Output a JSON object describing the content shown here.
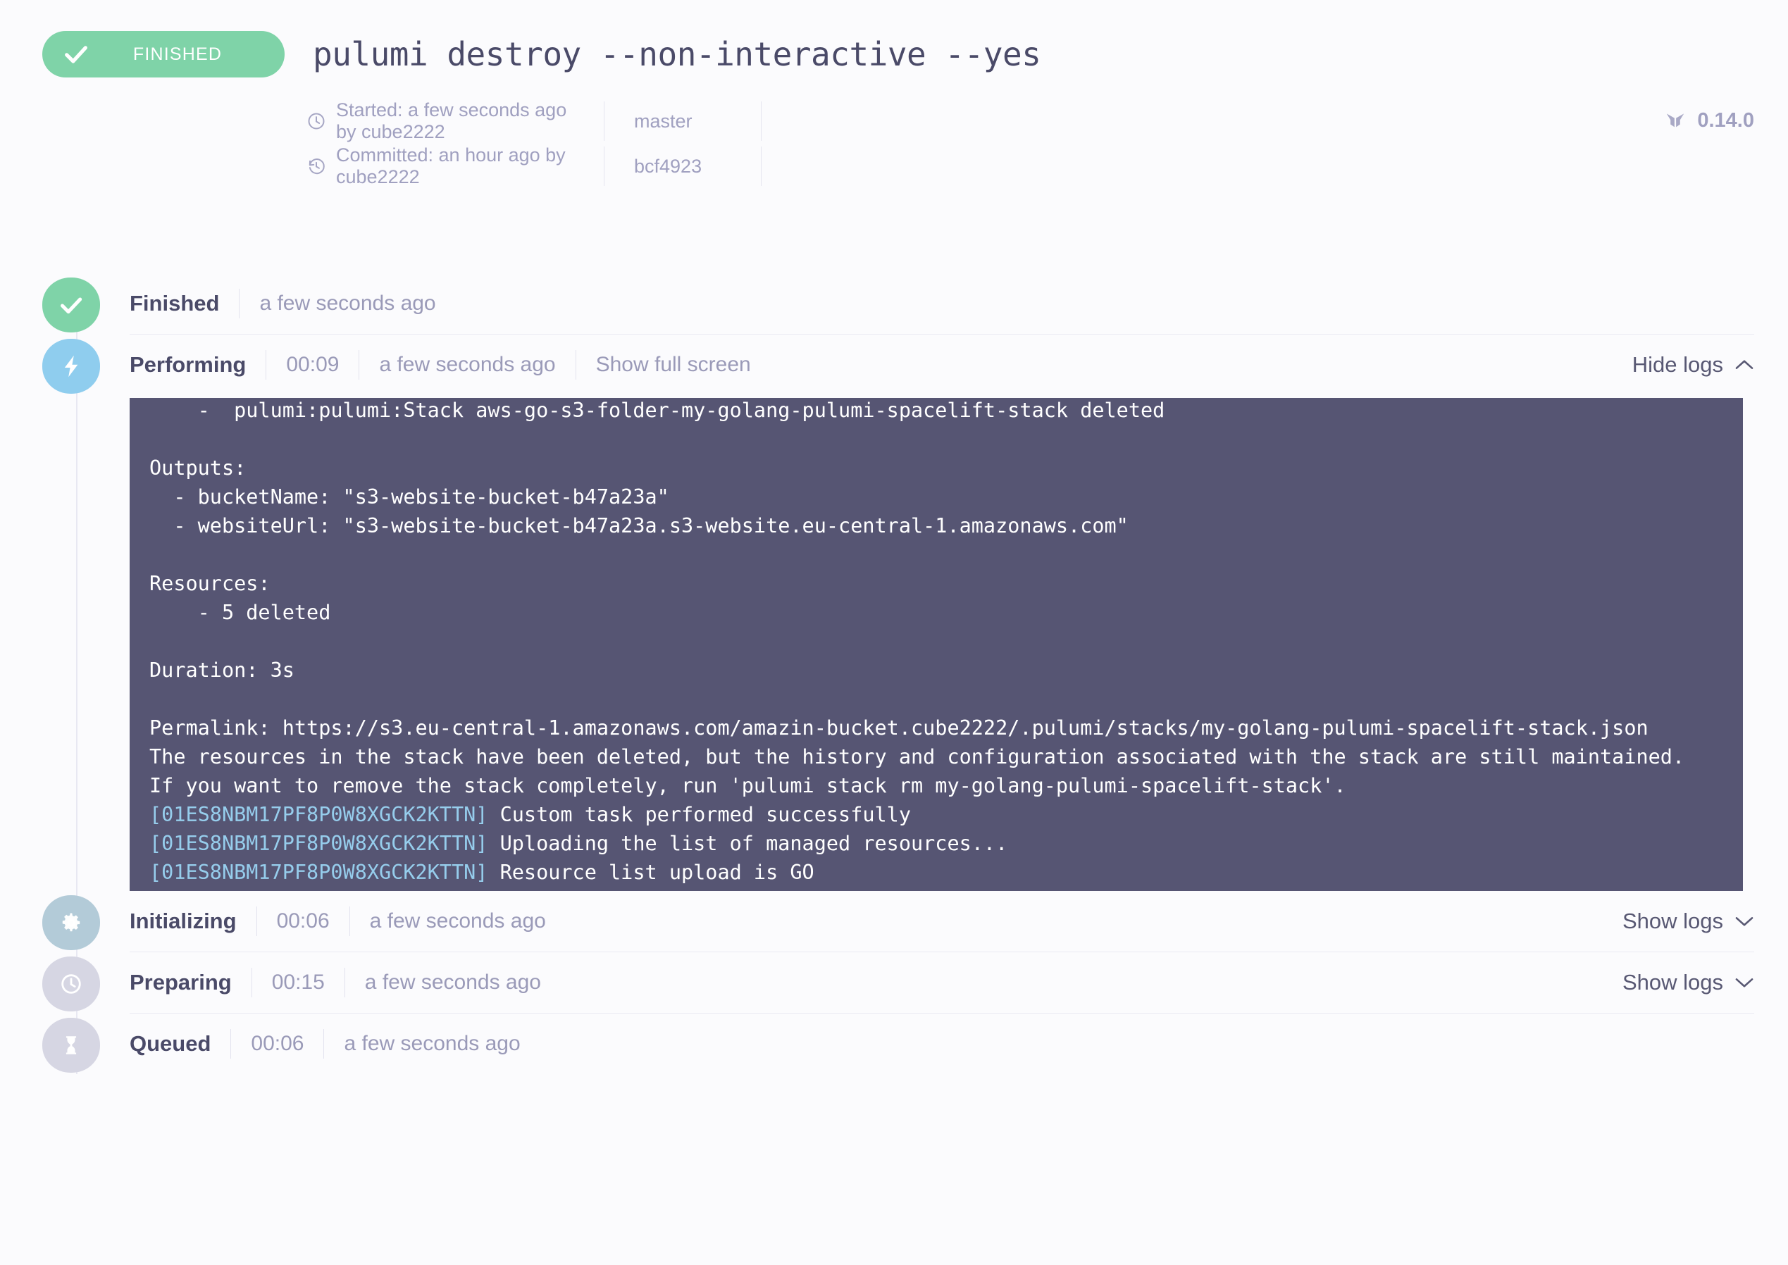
{
  "header": {
    "status_badge": {
      "label": "FINISHED",
      "icon": "check-icon",
      "color": "#7fd3a8"
    },
    "title": "pulumi destroy --non-interactive --yes",
    "meta": [
      {
        "icon": "clock-icon",
        "text": "Started: a few seconds ago by cube2222",
        "ref": "master"
      },
      {
        "icon": "history-icon",
        "text": "Committed: an hour ago by cube2222",
        "ref": "bcf4923"
      }
    ],
    "version": {
      "icon": "spacelift-logo-icon",
      "label": "0.14.0"
    }
  },
  "timeline": {
    "phases": [
      {
        "name": "Finished",
        "duration": "",
        "when": "a few seconds ago",
        "action": "",
        "toggle": "",
        "icon": "check-icon",
        "icon_style": "ic-green"
      },
      {
        "name": "Performing",
        "duration": "00:09",
        "when": "a few seconds ago",
        "action": "Show full screen",
        "toggle": "Hide logs",
        "toggle_chevron": "chevron-up-icon",
        "icon": "lightning-icon",
        "icon_style": "ic-blue"
      },
      {
        "name": "Initializing",
        "duration": "00:06",
        "when": "a few seconds ago",
        "action": "",
        "toggle": "Show logs",
        "toggle_chevron": "chevron-down-icon",
        "icon": "gear-icon",
        "icon_style": "ic-steel"
      },
      {
        "name": "Preparing",
        "duration": "00:15",
        "when": "a few seconds ago",
        "action": "",
        "toggle": "Show logs",
        "toggle_chevron": "chevron-down-icon",
        "icon": "clock-icon",
        "icon_style": "ic-grey"
      },
      {
        "name": "Queued",
        "duration": "00:06",
        "when": "a few seconds ago",
        "action": "",
        "toggle": "",
        "icon": "hourglass-icon",
        "icon_style": "ic-grey"
      }
    ]
  },
  "console": {
    "background": "#565573",
    "text_color": "#ffffff",
    "task_id_color": "#96cdec",
    "task_id": "[01ES8NBM17PF8P0W8XGCK2KTTN]",
    "lines": [
      {
        "text": "    -  pulumi:pulumi:Stack aws-go-s3-folder-my-golang-pulumi-spacelift-stack deleted"
      },
      {
        "text": ""
      },
      {
        "text": "Outputs:"
      },
      {
        "text": "  - bucketName: \"s3-website-bucket-b47a23a\""
      },
      {
        "text": "  - websiteUrl: \"s3-website-bucket-b47a23a.s3-website.eu-central-1.amazonaws.com\""
      },
      {
        "text": ""
      },
      {
        "text": "Resources:"
      },
      {
        "text": "    - 5 deleted"
      },
      {
        "text": ""
      },
      {
        "text": "Duration: 3s"
      },
      {
        "text": ""
      },
      {
        "text": "Permalink: https://s3.eu-central-1.amazonaws.com/amazin-bucket.cube2222/.pulumi/stacks/my-golang-pulumi-spacelift-stack.json"
      },
      {
        "text": "The resources in the stack have been deleted, but the history and configuration associated with the stack are still maintained."
      },
      {
        "text": "If you want to remove the stack completely, run 'pulumi stack rm my-golang-pulumi-spacelift-stack'."
      },
      {
        "tid": "[01ES8NBM17PF8P0W8XGCK2KTTN]",
        "text": " Custom task performed successfully"
      },
      {
        "tid": "[01ES8NBM17PF8P0W8XGCK2KTTN]",
        "text": " Uploading the list of managed resources..."
      },
      {
        "tid": "[01ES8NBM17PF8P0W8XGCK2KTTN]",
        "text": " Resource list upload is GO"
      }
    ]
  }
}
